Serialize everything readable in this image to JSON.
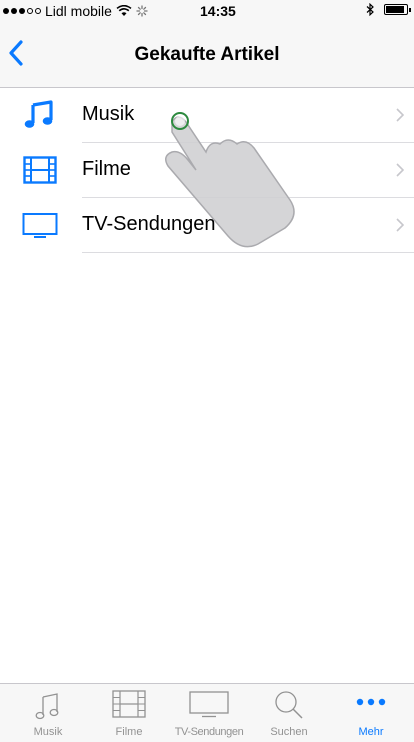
{
  "status_bar": {
    "carrier": "Lidl mobile",
    "time": "14:35",
    "signal_full": 3,
    "signal_empty": 2,
    "battery_level": 0.9
  },
  "nav": {
    "title": "Gekaufte Artikel",
    "back_icon": "chevron-left-icon"
  },
  "list": {
    "items": [
      {
        "label": "Musik",
        "icon": "music-note-icon"
      },
      {
        "label": "Filme",
        "icon": "film-icon"
      },
      {
        "label": "TV-Sendungen",
        "icon": "tv-icon"
      }
    ]
  },
  "tabs": [
    {
      "label": "Musik",
      "icon": "music-note-icon",
      "active": false
    },
    {
      "label": "Filme",
      "icon": "film-icon",
      "active": false
    },
    {
      "label": "TV-Sendungen",
      "icon": "tv-icon",
      "active": false
    },
    {
      "label": "Suchen",
      "icon": "search-icon",
      "active": false
    },
    {
      "label": "Mehr",
      "icon": "more-icon",
      "active": true
    }
  ],
  "colors": {
    "accent": "#0a7aff",
    "inactive": "#929292",
    "bar_background": "#f7f7f7"
  }
}
